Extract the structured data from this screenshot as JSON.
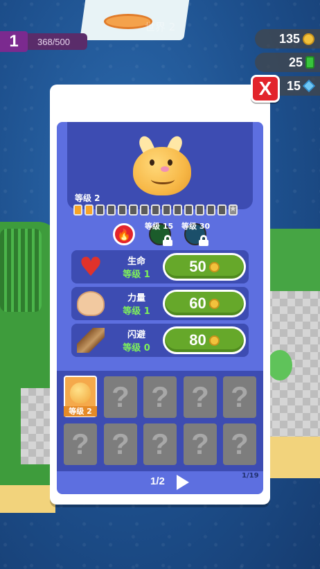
{
  "hud": {
    "level": "1",
    "xp": "368/500",
    "world": "世界 2",
    "coins": "135",
    "gems": "25",
    "diamonds": "15"
  },
  "panel": {
    "close_label": "X",
    "pet": {
      "level_label": "等级 2",
      "progress": {
        "filled": 2,
        "total": 15
      }
    },
    "skills": {
      "unlock_1": "等级 15",
      "unlock_2": "等级 30"
    },
    "stats": [
      {
        "name": "生命",
        "level": "等级 1",
        "cost": "50",
        "icon": "heart-icon"
      },
      {
        "name": "力量",
        "level": "等级 1",
        "cost": "60",
        "icon": "muscle-arm-icon"
      },
      {
        "name": "闪避",
        "level": "等级 0",
        "cost": "80",
        "icon": "feather-icon"
      }
    ],
    "collection": {
      "owned_label": "等级 2",
      "unknown": "?",
      "page": "1/2",
      "count": "1/19"
    }
  },
  "colors": {
    "panel_blue": "#5d6fe0",
    "dark_blue": "#3d4cb2",
    "button_green": "#66a82a",
    "close_red": "#e2242b",
    "level_green_text": "#7ef05a"
  }
}
